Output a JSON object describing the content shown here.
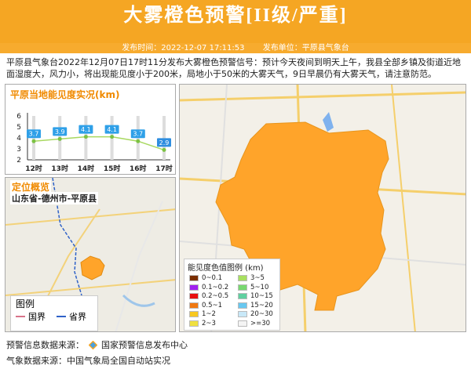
{
  "header": {
    "title": "大雾橙色预警[II级/严重]",
    "publish_time": "发布时间：2022-12-07 17:11:53",
    "publish_unit": "发布单位：平原县气象台",
    "bg_color": "#f5a623"
  },
  "description": "平原县气象台2022年12月07日17时11分发布大雾橙色预警信号：预计今天夜间到明天上午，我县全部乡镇及街道近地面湿度大，风力小，将出现能见度小于200米，局地小于50米的大雾天气，9日早晨仍有大雾天气，请注意防范。",
  "visibility_panel": {
    "title": "平原当地能见度实况(km)",
    "chart_data": {
      "type": "line",
      "categories": [
        "12时",
        "13时",
        "14时",
        "15时",
        "16时",
        "17时"
      ],
      "values": [
        3.7,
        3.9,
        4.1,
        4.1,
        3.7,
        2.9
      ],
      "ylim": [
        2,
        6
      ],
      "yticks": [
        "2",
        "3",
        "4",
        "5",
        "6"
      ]
    }
  },
  "location_panel": {
    "title": "定位概览",
    "subtitle": "山东省-德州市-平原县",
    "legend_title": "图例",
    "legend_items": [
      {
        "label": "国界",
        "color": "#d9738a"
      },
      {
        "label": "省界",
        "color": "#2f62c8"
      }
    ]
  },
  "map_panel": {
    "legend_title": "能见度色值图例 (km)",
    "legend_items": [
      {
        "label": "0~0.1",
        "color": "#7a2e00"
      },
      {
        "label": "3~5",
        "color": "#a8e060"
      },
      {
        "label": "0.1~0.2",
        "color": "#a020f0"
      },
      {
        "label": "5~10",
        "color": "#78d870"
      },
      {
        "label": "0.2~0.5",
        "color": "#e81010"
      },
      {
        "label": "10~15",
        "color": "#60d0a0"
      },
      {
        "label": "0.5~1",
        "color": "#f07810"
      },
      {
        "label": "15~20",
        "color": "#68c8f0"
      },
      {
        "label": "1~2",
        "color": "#f8c820"
      },
      {
        "label": "20~30",
        "color": "#c8e8f8"
      },
      {
        "label": "2~3",
        "color": "#f0e040"
      },
      {
        "label": ">=30",
        "color": "#f4f4f4"
      }
    ],
    "region_color": "#ffa42a"
  },
  "footer": {
    "source_warning": "预警信息数据来源：",
    "source_warning_name": "国家预警信息发布中心",
    "source_weather": "气象数据来源：中国气象局全国自动站实况"
  }
}
